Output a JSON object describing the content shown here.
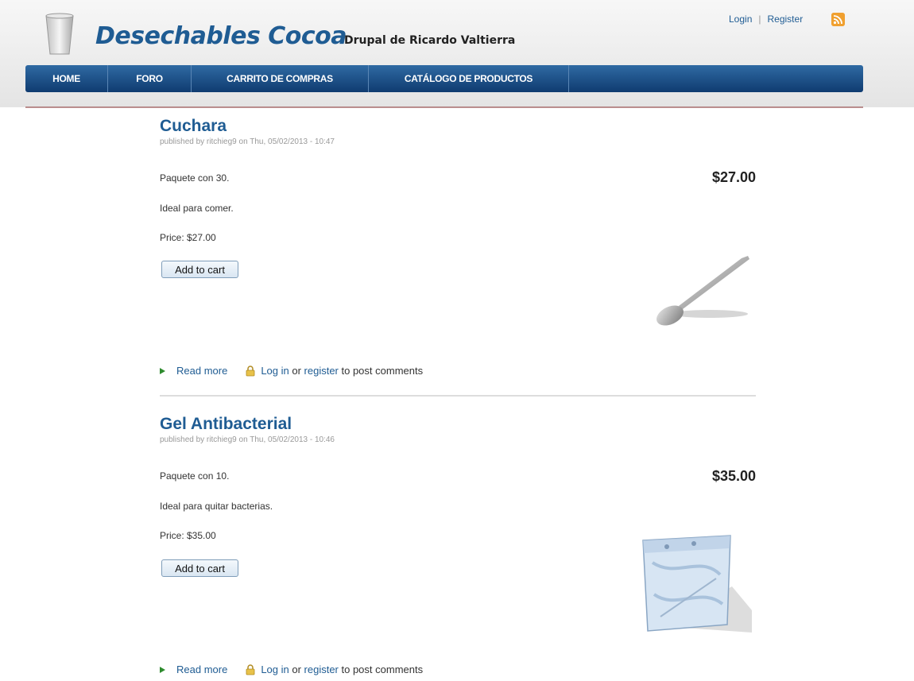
{
  "header": {
    "site_name": "Desechables Cocoa",
    "site_slogan": "Drupal de Ricardo Valtierra",
    "login_label": "Login",
    "separator": "|",
    "register_label": "Register"
  },
  "nav": {
    "items": [
      {
        "label": "HOME"
      },
      {
        "label": "FORO"
      },
      {
        "label": "CARRITO DE COMPRAS"
      },
      {
        "label": "CATÁLOGO DE PRODUCTOS"
      }
    ]
  },
  "products": [
    {
      "title": "Cuchara",
      "meta": "published by ritchieg9 on Thu, 05/02/2013 - 10:47",
      "price_display": "$27.00",
      "description_1": "Paquete con 30.",
      "description_2": "Ideal para comer.",
      "price_line": "Price: $27.00",
      "add_to_cart": "Add to cart",
      "read_more": "Read more",
      "log_in": "Log in",
      "or_text": " or ",
      "register": "register",
      "post_comments": " to post comments"
    },
    {
      "title": "Gel Antibacterial",
      "meta": "published by ritchieg9 on Thu, 05/02/2013 - 10:46",
      "price_display": "$35.00",
      "description_1": "Paquete con 10.",
      "description_2": "Ideal para quitar bacterias.",
      "price_line": "Price: $35.00",
      "add_to_cart": "Add to cart",
      "read_more": "Read more",
      "log_in": "Log in",
      "or_text": " or ",
      "register": "register",
      "post_comments": " to post comments"
    }
  ],
  "colors": {
    "brand_blue": "#1f5c93",
    "nav_dark": "#0f3b70",
    "rss_orange": "#f0a030"
  }
}
